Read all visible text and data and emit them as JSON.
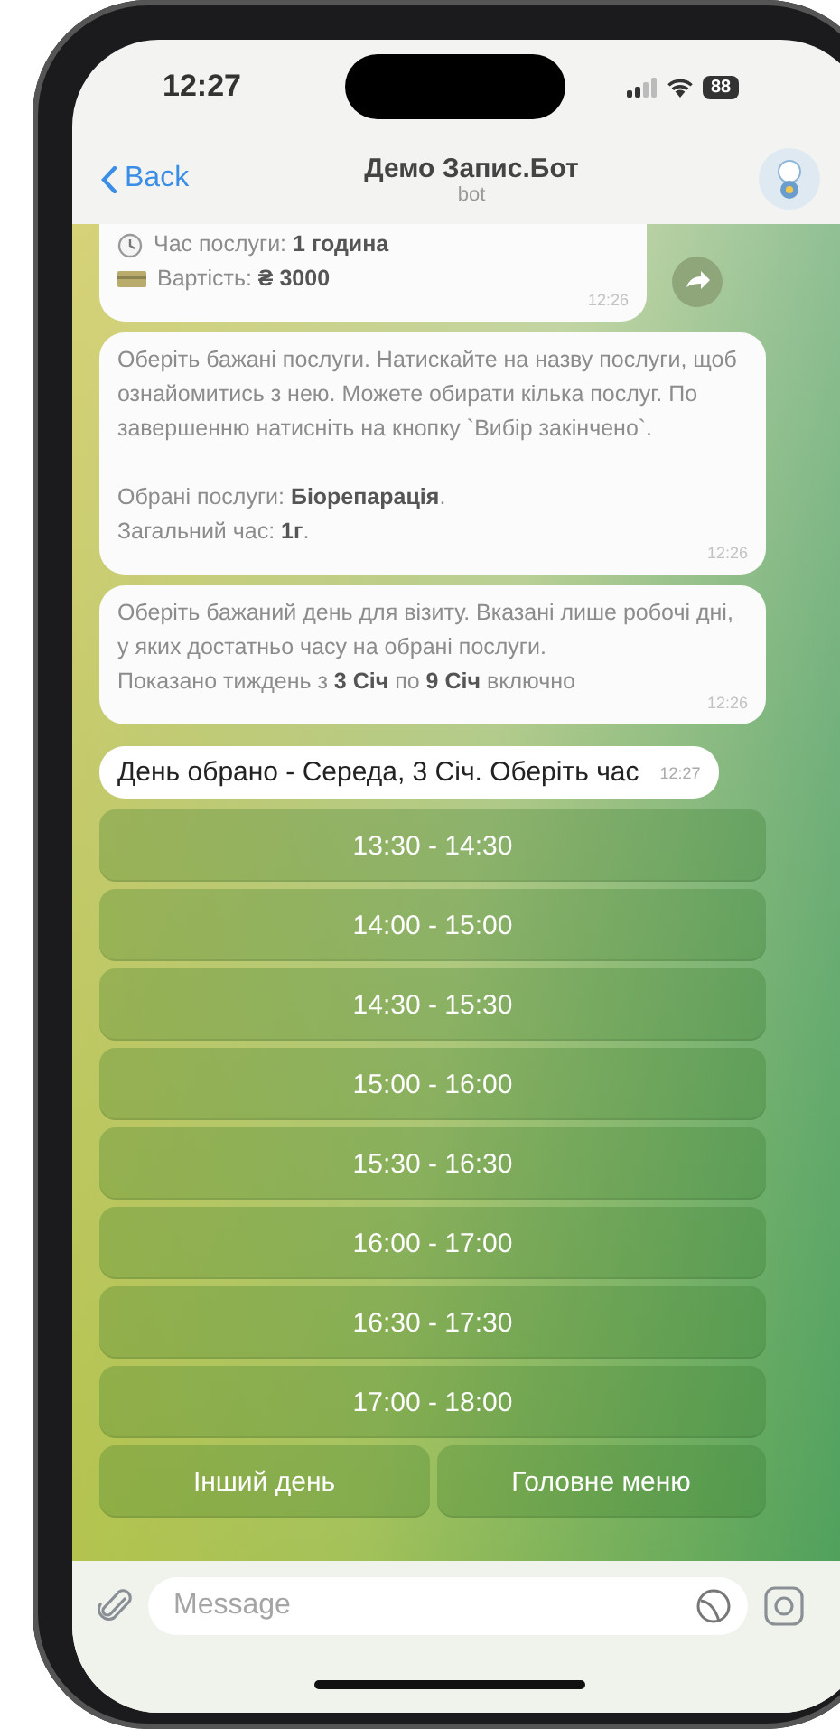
{
  "status_bar": {
    "time": "12:27",
    "battery": "88"
  },
  "header": {
    "back": "Back",
    "title": "Демо Запис.Бот",
    "subtitle": "bot"
  },
  "messages": [
    {
      "kind": "card",
      "faded": true,
      "time": "12:26",
      "rows": [
        {
          "kind": "duration",
          "text": "Час послуги: **1 година**"
        },
        {
          "kind": "price",
          "text": "Вартість: **₴ 3000**"
        }
      ]
    },
    {
      "kind": "text",
      "faded": true,
      "time": "12:26",
      "paragraphs": [
        [
          "Оберіть бажані послуги. Натискайте на назву послуги, щоб ознайомитись з нею. Можете обирати кілька послуг. По завершенню натисніть на кнопку `Вибір закінчено`."
        ],
        [
          "Обрані послуги: **Біорепарація**.",
          "Загальний час: **1г**."
        ]
      ]
    },
    {
      "kind": "text",
      "faded": true,
      "time": "12:26",
      "paragraphs": [
        [
          "Оберіть бажаний день для візиту. Вказані лише робочі дні, у яких достатньо часу на обрані послуги.",
          "Показано тиждень з **3 Січ** по **9 Січ** включно"
        ]
      ]
    },
    {
      "kind": "text",
      "faded": false,
      "time": "12:27",
      "paragraphs": [
        [
          "День обрано - Середа, 3 Січ. Оберіть час"
        ]
      ]
    }
  ],
  "keyboard": [
    [
      "13:30 - 14:30"
    ],
    [
      "14:00 - 15:00"
    ],
    [
      "14:30 - 15:30"
    ],
    [
      "15:00 - 16:00"
    ],
    [
      "15:30 - 16:30"
    ],
    [
      "16:00 - 17:00"
    ],
    [
      "16:30 - 17:30"
    ],
    [
      "17:00 - 18:00"
    ],
    [
      "Інший день",
      "Головне меню"
    ]
  ],
  "input": {
    "placeholder": "Message"
  }
}
